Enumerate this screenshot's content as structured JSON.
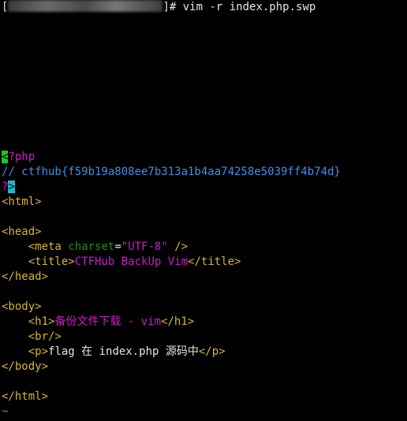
{
  "prompt": {
    "open_bracket": "[",
    "suffix": "]# vim -r index.php.swp"
  },
  "code": {
    "php_open_cursor": "<",
    "php_open_rest": "?php",
    "comment": "// ctfhub{f59b19a808ee7b313a1b4aa74258e5039ff4b74d}",
    "php_close_q": "?",
    "php_close_cursor": ">",
    "html_open": "<html>",
    "head_open": "<head>",
    "meta_open": "<meta",
    "meta_attr": "charset",
    "meta_eq": "=",
    "meta_val": "\"UTF-8\"",
    "meta_close": "/>",
    "title_open": "<title>",
    "title_text": "CTFHub BackUp Vim",
    "title_close": "</title>",
    "head_close": "</head>",
    "body_open": "<body>",
    "h1_open": "<h1>",
    "h1_text": "备份文件下载 - vim",
    "h1_close": "</h1>",
    "br": "<br/>",
    "p_open": "<p>",
    "p_text": "flag 在 index.php 源码中",
    "p_close": "</p>",
    "body_close": "</body>",
    "html_close": "</html>",
    "tilde": "~"
  },
  "colors": {
    "background": "#000000",
    "tag": "#d6b62e",
    "attribute": "#1e8a1e",
    "string": "#c81ec8",
    "comment": "#3f8fe6",
    "cursor_green": "#21c521",
    "cursor_cyan": "#1fb8c8"
  }
}
